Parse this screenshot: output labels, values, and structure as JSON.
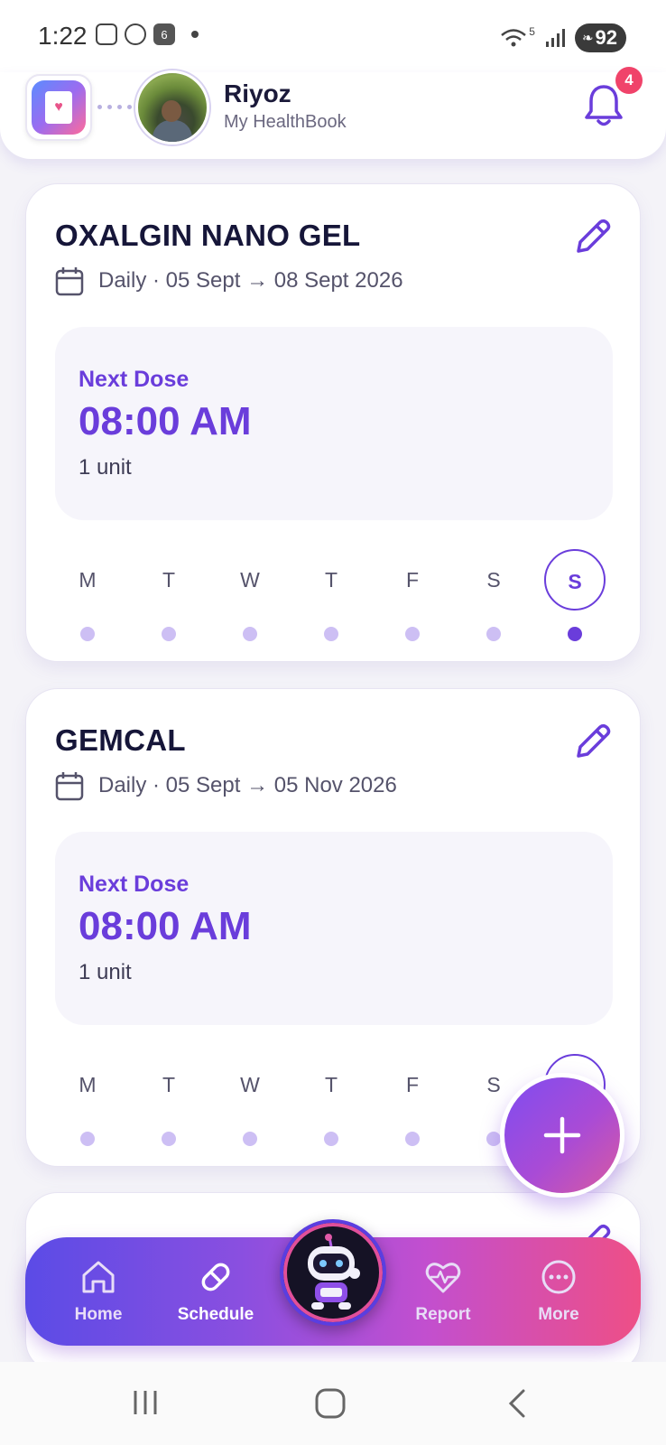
{
  "status_bar": {
    "time": "1:22",
    "calendar_badge": "6",
    "battery": "92",
    "signal_label": "5"
  },
  "header": {
    "user_name": "Riyoz",
    "subtitle": "My HealthBook",
    "notification_count": "4"
  },
  "medications": [
    {
      "name": "OXALGIN NANO GEL",
      "schedule": "Daily · 05 Sept → 08 Sept 2026",
      "next_dose_label": "Next Dose",
      "next_dose_time": "08:00 AM",
      "dose_amount": "1 unit",
      "days": [
        "M",
        "T",
        "W",
        "T",
        "F",
        "S",
        "S"
      ],
      "active_day_index": 6
    },
    {
      "name": "GEMCAL",
      "schedule": "Daily · 05 Sept → 05 Nov 2026",
      "next_dose_label": "Next Dose",
      "next_dose_time": "08:00 AM",
      "dose_amount": "1 unit",
      "days": [
        "M",
        "T",
        "W",
        "T",
        "F",
        "S",
        "S"
      ],
      "active_day_index": 6
    }
  ],
  "bottom_nav": {
    "items": [
      {
        "label": "Home",
        "icon": "home-icon"
      },
      {
        "label": "Schedule",
        "icon": "pill-icon",
        "active": true
      },
      {
        "label": "Report",
        "icon": "heart-pulse-icon"
      },
      {
        "label": "More",
        "icon": "more-icon"
      }
    ]
  },
  "colors": {
    "accent": "#6a3ddb",
    "badge": "#f0436a",
    "nav_gradient_start": "#5b4be6",
    "nav_gradient_end": "#ee4f86"
  }
}
